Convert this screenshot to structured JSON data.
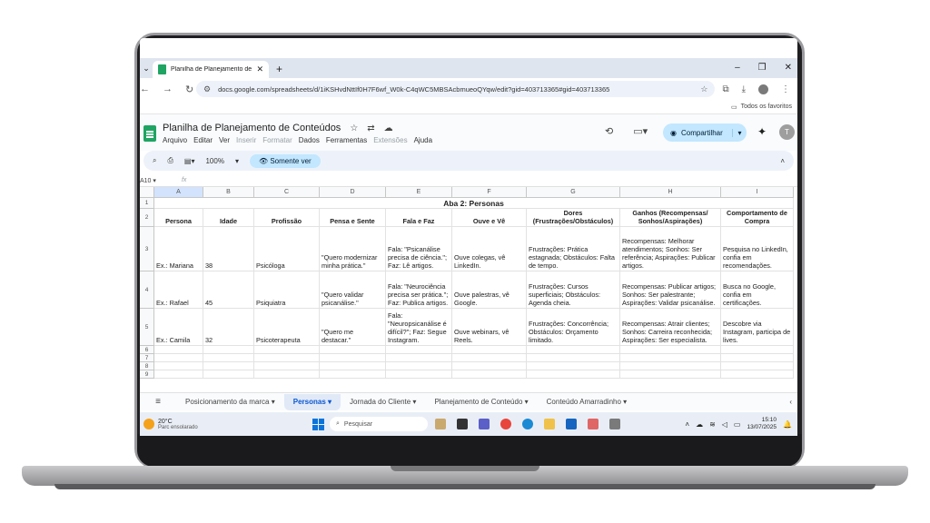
{
  "browser": {
    "tab_title": "Planilha de Planejamento de C...",
    "url": "docs.google.com/spreadsheets/d/1iKSHvdNttIf0H7F6wf_W0k-C4qWC5MBSAcbmueoQYqw/edit?gid=403713365#gid=403713365",
    "bookmarks_label": "Todos os favoritos"
  },
  "sheets": {
    "doc_title": "Planilha de Planejamento de Conteúdos",
    "menu": [
      "Arquivo",
      "Editar",
      "Ver",
      "Inserir",
      "Formatar",
      "Dados",
      "Ferramentas",
      "Extensões",
      "Ajuda"
    ],
    "share_label": "Compartilhar",
    "avatar_letter": "T",
    "zoom": "100%",
    "view_mode": "Somente ver",
    "cell_ref": "A10",
    "fx": "fx"
  },
  "grid": {
    "columns": [
      "A",
      "B",
      "C",
      "D",
      "E",
      "F",
      "G",
      "H",
      "I"
    ],
    "rows": [
      "1",
      "2",
      "3",
      "4",
      "5",
      "6",
      "7",
      "8",
      "9"
    ],
    "title": "Aba 2: Personas",
    "headers": [
      "Persona",
      "Idade",
      "Profissão",
      "Pensa e Sente",
      "Fala e Faz",
      "Ouve e Vê",
      "Dores (Frustrações/Obstáculos)",
      "Ganhos (Recompensas/ Sonhos/Aspirações)",
      "Comportamento de Compra"
    ],
    "data": [
      [
        "Ex.: Mariana",
        "38",
        "Psicóloga",
        "\"Quero modernizar minha prática.\"",
        "Fala: \"Psicanálise precisa de ciência.\"; Faz: Lê artigos.",
        "Ouve colegas, vê LinkedIn.",
        "Frustrações: Prática estagnada; Obstáculos: Falta de tempo.",
        "Recompensas: Melhorar atendimentos; Sonhos: Ser referência; Aspirações: Publicar artigos.",
        "Pesquisa no LinkedIn, confia em recomendações."
      ],
      [
        "Ex.: Rafael",
        "45",
        "Psiquiatra",
        "\"Quero validar psicanálise.\"",
        "Fala: \"Neurociência precisa ser prática.\"; Faz: Publica artigos.",
        "Ouve palestras, vê Google.",
        "Frustrações: Cursos superficiais; Obstáculos: Agenda cheia.",
        "Recompensas: Publicar artigos; Sonhos: Ser palestrante; Aspirações: Validar psicanálise.",
        "Busca no Google, confia em certificações."
      ],
      [
        "Ex.: Camila",
        "32",
        "Psicoterapeuta",
        "\"Quero me destacar.\"",
        "Fala: \"Neuropsicanálise é difícil?\"; Faz: Segue Instagram.",
        "Ouve webinars, vê Reels.",
        "Frustrações: Concorrência; Obstáculos: Orçamento limitado.",
        "Recompensas: Atrair clientes; Sonhos: Carreira reconhecida; Aspirações: Ser especialista.",
        "Descobre via Instagram, participa de lives."
      ]
    ]
  },
  "sheet_tabs": [
    "Posicionamento da marca",
    "Personas",
    "Jornada do Cliente",
    "Planejamento de Conteúdo",
    "Conteúdo Amarradinho"
  ],
  "taskbar": {
    "temperature": "20°C",
    "weather": "Parc ensolarado",
    "search_placeholder": "Pesquisar",
    "time": "15:10",
    "date": "13/07/2025",
    "notification_count": "1"
  }
}
